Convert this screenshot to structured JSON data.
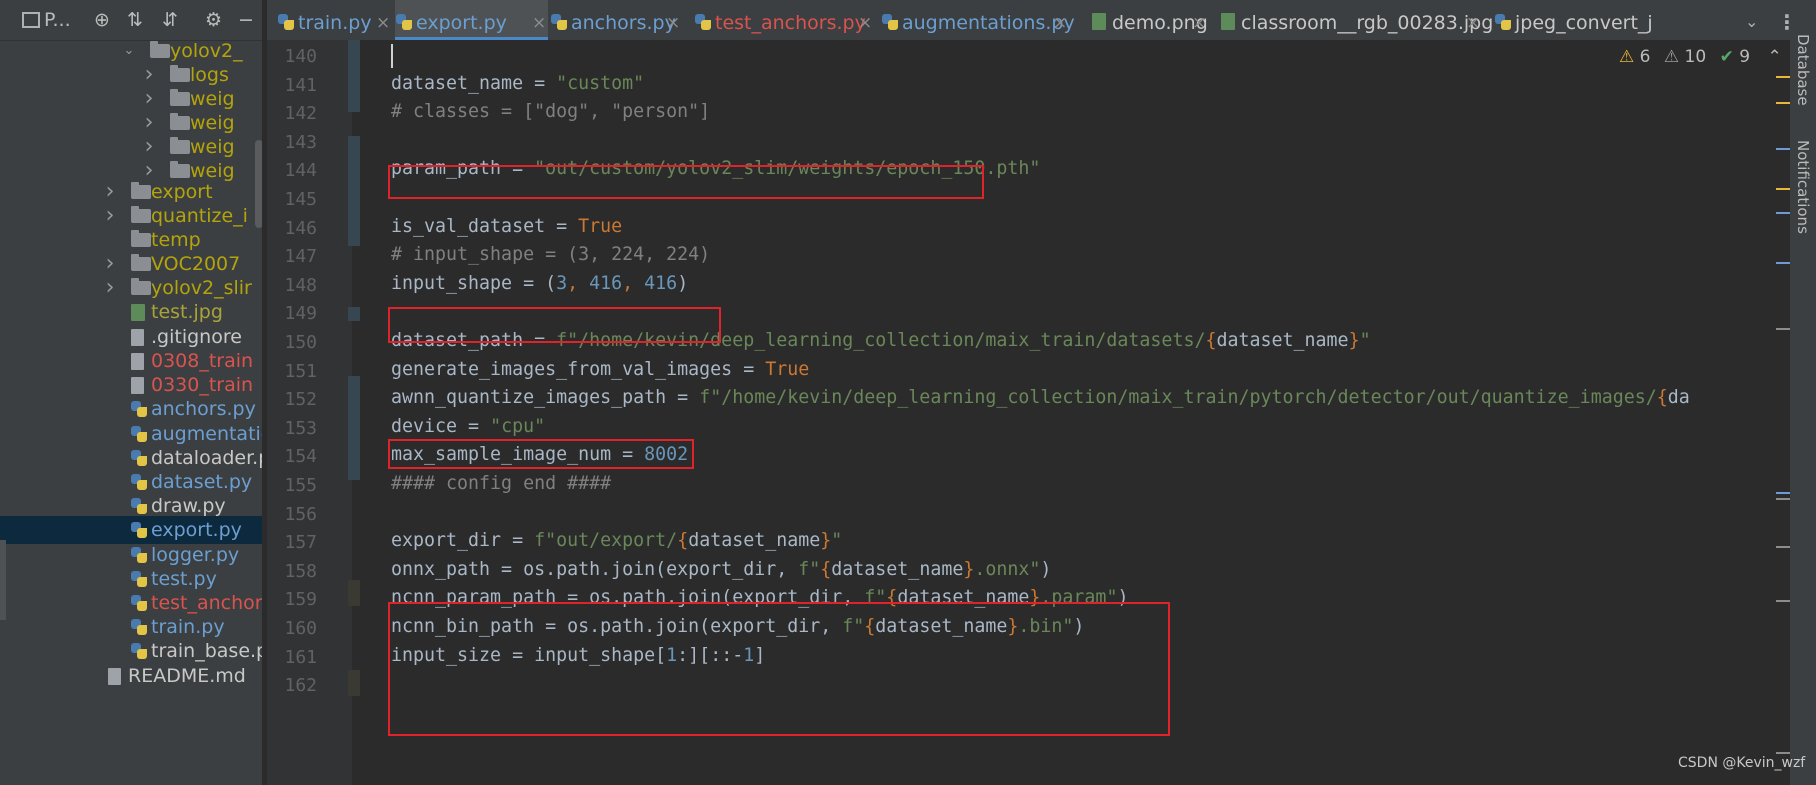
{
  "sidebar": {
    "title": "P...",
    "tree": [
      {
        "label": "yolov2_",
        "type": "folder",
        "arrow": "down",
        "color": "yellow"
      },
      {
        "label": "logs",
        "type": "folder",
        "arrow": "right",
        "color": "yellow"
      },
      {
        "label": "weig",
        "type": "folder",
        "arrow": "right",
        "color": "yellow"
      },
      {
        "label": "weig",
        "type": "folder",
        "arrow": "right",
        "color": "yellow"
      },
      {
        "label": "weig",
        "type": "folder",
        "arrow": "right",
        "color": "yellow"
      },
      {
        "label": "weig",
        "type": "folder",
        "arrow": "right",
        "color": "yellow"
      },
      {
        "label": "export",
        "type": "folder",
        "arrow": "right",
        "color": "yellow"
      },
      {
        "label": "quantize_i",
        "type": "folder",
        "arrow": "right",
        "color": "yellow"
      },
      {
        "label": "temp",
        "type": "folder",
        "arrow": "none",
        "color": "yellow"
      },
      {
        "label": "VOC2007",
        "type": "folder",
        "arrow": "right",
        "color": "yellow"
      },
      {
        "label": "yolov2_slir",
        "type": "folder",
        "arrow": "right",
        "color": "yellow"
      },
      {
        "label": "test.jpg",
        "type": "image",
        "arrow": "none",
        "color": "yellowgreen"
      },
      {
        "label": ".gitignore",
        "type": "file",
        "arrow": "none",
        "color": "white"
      },
      {
        "label": "0308_train",
        "type": "file",
        "arrow": "none",
        "color": "red"
      },
      {
        "label": "0330_train",
        "type": "file",
        "arrow": "none",
        "color": "red"
      },
      {
        "label": "anchors.py",
        "type": "py",
        "arrow": "none",
        "color": "blue"
      },
      {
        "label": "augmentatio",
        "type": "py",
        "arrow": "none",
        "color": "blue"
      },
      {
        "label": "dataloader.p",
        "type": "py",
        "arrow": "none",
        "color": "white"
      },
      {
        "label": "dataset.py",
        "type": "py",
        "arrow": "none",
        "color": "blue"
      },
      {
        "label": "draw.py",
        "type": "py",
        "arrow": "none",
        "color": "white"
      },
      {
        "label": "export.py",
        "type": "py",
        "arrow": "none",
        "color": "blue",
        "selected": true
      },
      {
        "label": "logger.py",
        "type": "py",
        "arrow": "none",
        "color": "blue"
      },
      {
        "label": "test.py",
        "type": "py",
        "arrow": "none",
        "color": "blue"
      },
      {
        "label": "test_anchors",
        "type": "py",
        "arrow": "none",
        "color": "red"
      },
      {
        "label": "train.py",
        "type": "py",
        "arrow": "none",
        "color": "blue"
      },
      {
        "label": "train_base.py",
        "type": "py",
        "arrow": "none",
        "color": "white"
      },
      {
        "label": "README.md",
        "type": "file",
        "arrow": "none",
        "color": "white"
      }
    ]
  },
  "tabs": [
    {
      "label": "train.py",
      "icon": "python-file-icon",
      "color": "blue",
      "active": false
    },
    {
      "label": "export.py",
      "icon": "python-file-icon",
      "color": "blue",
      "active": true
    },
    {
      "label": "anchors.py",
      "icon": "python-file-icon",
      "color": "blue",
      "active": false
    },
    {
      "label": "test_anchors.py",
      "icon": "python-file-icon",
      "color": "red",
      "active": false
    },
    {
      "label": "augmentations.py",
      "icon": "python-file-icon",
      "color": "blue",
      "active": false
    },
    {
      "label": "demo.png",
      "icon": "image-file-icon",
      "color": "white",
      "active": false
    },
    {
      "label": "classroom__rgb_00283.jpg",
      "icon": "image-file-icon",
      "color": "white",
      "active": false
    },
    {
      "label": "jpeg_convert_j",
      "icon": "python-file-icon",
      "color": "white",
      "active": false
    }
  ],
  "inspections": {
    "warnings": "6",
    "weak_warnings": "10",
    "ok": "9"
  },
  "editor": {
    "lines": [
      {
        "no": "140"
      },
      {
        "no": "141"
      },
      {
        "no": "142"
      },
      {
        "no": "143"
      },
      {
        "no": "144"
      },
      {
        "no": "145"
      },
      {
        "no": "146"
      },
      {
        "no": "147"
      },
      {
        "no": "148"
      },
      {
        "no": "149"
      },
      {
        "no": "150"
      },
      {
        "no": "151"
      },
      {
        "no": "152"
      },
      {
        "no": "153"
      },
      {
        "no": "154"
      },
      {
        "no": "155"
      },
      {
        "no": "156"
      },
      {
        "no": "157"
      },
      {
        "no": "158"
      },
      {
        "no": "159"
      },
      {
        "no": "160"
      },
      {
        "no": "161"
      },
      {
        "no": "162"
      }
    ],
    "code": {
      "l141": {
        "a": "dataset_name = ",
        "b": "\"custom\""
      },
      "l142": "# classes = [\"dog\", \"person\"]",
      "l144": {
        "a": "param_path = ",
        "b": "\"out/custom/yolov2_slim/weights/epoch_150.pth\""
      },
      "l146": {
        "a": "is_val_dataset = ",
        "b": "True"
      },
      "l147": "# input_shape = (3, 224, 224)",
      "l148": {
        "a": "input_shape = (",
        "n1": "3",
        "c1": ", ",
        "n2": "416",
        "c2": ", ",
        "n3": "416",
        "z": ")"
      },
      "l150": {
        "a": "dataset_path = ",
        "f": "f\"/home/kevin/deep_learning_collection/maix_train/datasets/",
        "o": "{",
        "v": "dataset_name",
        "c": "}",
        "e": "\""
      },
      "l151": {
        "a": "generate_images_from_val_images = ",
        "b": "True"
      },
      "l152": {
        "a": "awnn_quantize_images_path",
        "eq": " = ",
        "f": "f\"/home/kevin/deep_learning_collection/maix_train/pytorch/detector/out/quantize_images/",
        "o": "{",
        "v": "da"
      },
      "l153": {
        "a": "device = ",
        "b": "\"cpu\""
      },
      "l154": {
        "a": "max_sample_image_num = ",
        "b": "8002"
      },
      "l155": "#### config end ####",
      "l157": {
        "a": "export_dir = ",
        "f": "f\"out/export/",
        "o": "{",
        "v": "dataset_name",
        "c": "}",
        "e": "\""
      },
      "l158": {
        "a": "onnx_path = os.path.join(export_dir, ",
        "f": "f\"",
        "o": "{",
        "v": "dataset_name",
        "c": "}",
        "e": ".onnx\"",
        "z": ")"
      },
      "l159": {
        "a": "ncnn_param_path = os.path.join(export_dir, ",
        "f": "f\"",
        "o": "{",
        "v": "dataset_name",
        "c": "}",
        "e": ".param\"",
        "z": ")"
      },
      "l160": {
        "a": "ncnn_bin_path = os.path.join(export_dir, ",
        "f": "f\"",
        "o": "{",
        "v": "dataset_name",
        "c": "}",
        "e": ".bin\"",
        "z": ")"
      },
      "l161": {
        "a": "input_size = input_shape[",
        "n1": "1",
        "b": ":][::-",
        "n2": "1",
        "z": "]"
      }
    }
  },
  "right_tools": {
    "database": "Database",
    "notifications": "Notifications"
  },
  "watermark": "CSDN @Kevin_wzf",
  "colors": {
    "keyword": "#cc7832",
    "string": "#6a8759",
    "number": "#6897bb",
    "comment": "#808080",
    "highlight_box": "#e0222a",
    "selection": "#0d293e"
  }
}
